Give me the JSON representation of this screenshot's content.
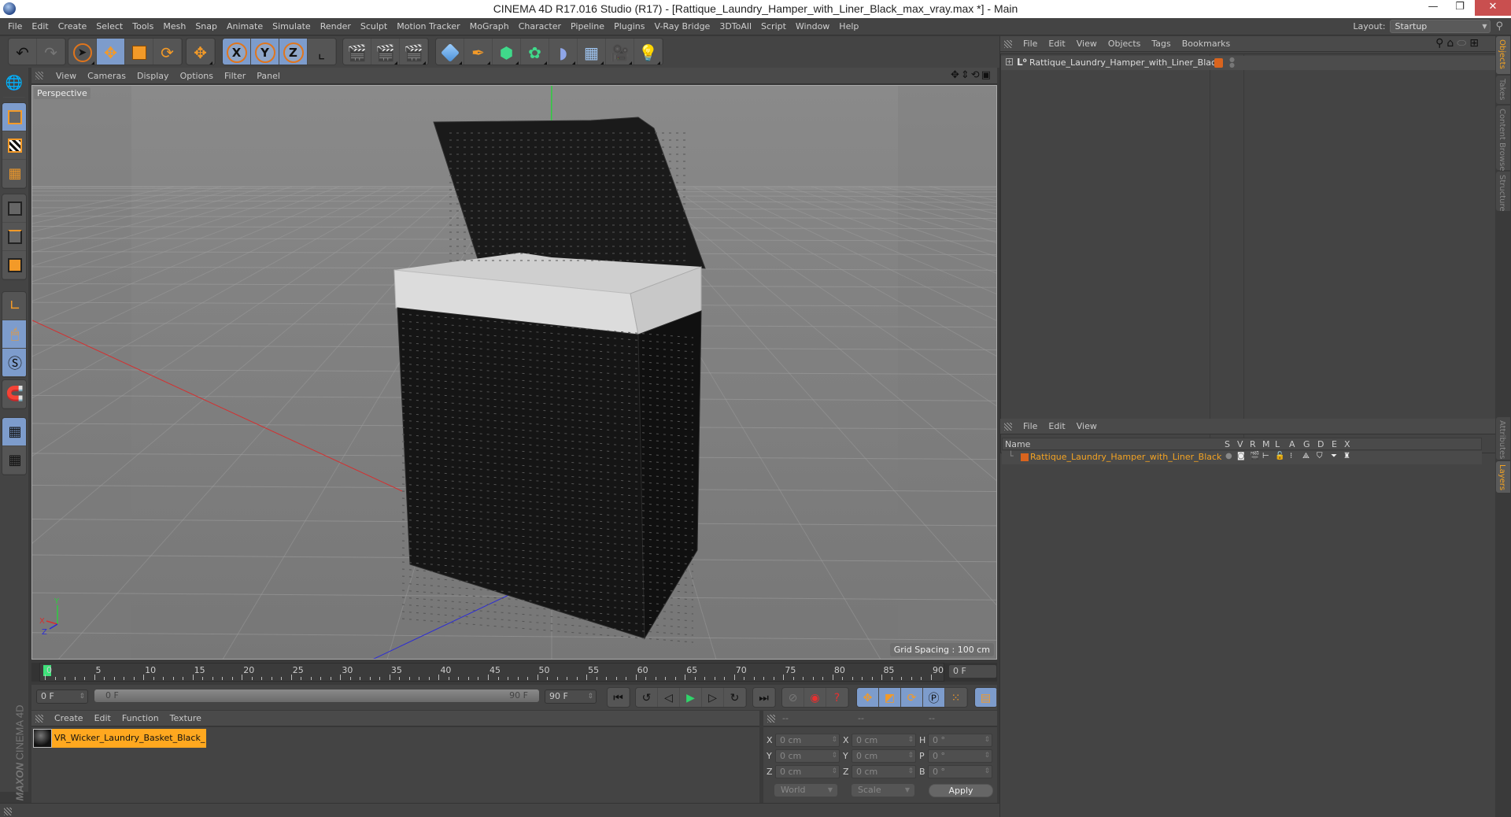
{
  "window": {
    "title": "CINEMA 4D R17.016 Studio (R17) - [Rattique_Laundry_Hamper_with_Liner_Black_max_vray.max *] - Main",
    "minimize": "—",
    "maximize": "❐",
    "close": "✕"
  },
  "menubar": {
    "items": [
      "File",
      "Edit",
      "Create",
      "Select",
      "Tools",
      "Mesh",
      "Snap",
      "Animate",
      "Simulate",
      "Render",
      "Sculpt",
      "Motion Tracker",
      "MoGraph",
      "Character",
      "Pipeline",
      "Plugins",
      "V-Ray Bridge",
      "3DToAll",
      "Script",
      "Window",
      "Help"
    ],
    "layout_label": "Layout:",
    "layout_value": "Startup"
  },
  "toolbar": {
    "undo": "↶",
    "redo": "↷",
    "axis_x": "X",
    "axis_y": "Y",
    "axis_z": "Z",
    "icons": [
      "undo-icon",
      "redo-icon",
      "live-selection-icon",
      "move-icon",
      "scale-icon",
      "rotate-icon",
      "recent-tool-icon",
      "x-axis-icon",
      "y-axis-icon",
      "z-axis-icon",
      "coordinate-system-icon",
      "render-view-icon",
      "render-picture-viewer-icon",
      "edit-render-settings-icon",
      "cube-icon",
      "pen-icon",
      "subdivision-icon",
      "cloner-icon",
      "deformer-icon",
      "floor-icon",
      "camera-icon",
      "light-icon"
    ]
  },
  "left_tools": {
    "icons": [
      "make-editable-icon",
      "model-mode-icon",
      "texture-mode-icon",
      "workplane-mode-icon",
      "points-mode-icon",
      "edges-mode-icon",
      "polygons-mode-icon",
      "axis-mode-icon",
      "tweak-mode-icon",
      "solo-icon",
      "snap-icon",
      "workplane-lock-icon",
      "workplane-align-icon"
    ]
  },
  "viewport": {
    "menu": [
      "View",
      "Cameras",
      "Display",
      "Options",
      "Filter",
      "Panel"
    ],
    "label": "Perspective",
    "grid_spacing": "Grid Spacing : 100 cm",
    "axis_labels": {
      "x": "X",
      "y": "Y",
      "z": "Z"
    },
    "colors": {
      "x_axis": "#d43030",
      "y_axis": "#2ecc40",
      "z_axis": "#2b2bd6",
      "background": "#848484"
    }
  },
  "timeline": {
    "ticks": [
      "0",
      "5",
      "10",
      "15",
      "20",
      "25",
      "30",
      "35",
      "40",
      "45",
      "50",
      "55",
      "60",
      "65",
      "70",
      "75",
      "80",
      "85",
      "90"
    ],
    "current_frame": "0 F",
    "playhead_frame": 0
  },
  "transport": {
    "start_field": "0 F",
    "range_start": "0 F",
    "range_end": "90 F",
    "end_field": "90 F",
    "buttons": [
      "go-to-start-icon",
      "previous-key-icon",
      "previous-frame-icon",
      "play-icon",
      "next-frame-icon",
      "next-key-icon",
      "go-to-end-icon",
      "record-off-icon",
      "record-icon",
      "autokey-icon",
      "keyframe-position-icon",
      "keyframe-scale-icon",
      "keyframe-rotation-icon",
      "keyframe-param-icon",
      "keyframe-pla-icon",
      "timeline-icon"
    ]
  },
  "material_manager": {
    "menu": [
      "Create",
      "Edit",
      "Function",
      "Texture"
    ],
    "materials": [
      {
        "name": "VR_Wicker_Laundry_Basket_Black_"
      }
    ],
    "logo_brand": "MAXON",
    "logo_product": "CINEMA 4D"
  },
  "coordinates": {
    "headers": [
      "--",
      "--",
      "--"
    ],
    "rows": [
      {
        "l1": "X",
        "v1": "0 cm",
        "l2": "X",
        "v2": "0 cm",
        "l3": "H",
        "v3": "0 °"
      },
      {
        "l1": "Y",
        "v1": "0 cm",
        "l2": "Y",
        "v2": "0 cm",
        "l3": "P",
        "v3": "0 °"
      },
      {
        "l1": "Z",
        "v1": "0 cm",
        "l2": "Z",
        "v2": "0 cm",
        "l3": "B",
        "v3": "0 °"
      }
    ],
    "space": "World",
    "mode": "Scale",
    "apply": "Apply"
  },
  "object_manager": {
    "menu": [
      "File",
      "Edit",
      "View",
      "Objects",
      "Tags",
      "Bookmarks"
    ],
    "objects": [
      {
        "name": "Rattique_Laundry_Hamper_with_Liner_Black",
        "color": "#d9641e"
      }
    ]
  },
  "layer_manager": {
    "menu": [
      "File",
      "Edit",
      "View"
    ],
    "columns": [
      "Name",
      "S",
      "V",
      "R",
      "M",
      "L",
      "A",
      "G",
      "D",
      "E",
      "X"
    ],
    "layers": [
      {
        "name": "Rattique_Laundry_Hamper_with_Liner_Black",
        "color": "#d9641e"
      }
    ]
  },
  "side_tabs": {
    "top": [
      "Objects",
      "Takes",
      "Content Browser",
      "Structure"
    ],
    "bottom": [
      "Attributes",
      "Layers"
    ]
  }
}
